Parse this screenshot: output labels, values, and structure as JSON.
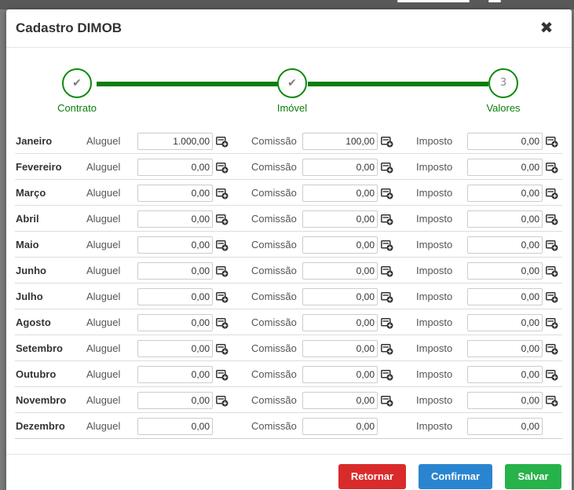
{
  "dialog": {
    "title": "Cadastro DIMOB",
    "close_glyph": "✖"
  },
  "stepper": {
    "steps": [
      {
        "label": "Contrato",
        "state": "done",
        "glyph": "✔"
      },
      {
        "label": "Imóvel",
        "state": "done",
        "glyph": "✔"
      },
      {
        "label": "Valores",
        "state": "current",
        "glyph": "3"
      }
    ],
    "color": "#0a7d0a"
  },
  "columns": {
    "aluguel": "Aluguel",
    "comissao": "Comissão",
    "imposto": "Imposto"
  },
  "months": [
    {
      "name": "Janeiro",
      "aluguel": "1.000,00",
      "comissao": "100,00",
      "imposto": "0,00",
      "has_calc": true
    },
    {
      "name": "Fevereiro",
      "aluguel": "0,00",
      "comissao": "0,00",
      "imposto": "0,00",
      "has_calc": true
    },
    {
      "name": "Março",
      "aluguel": "0,00",
      "comissao": "0,00",
      "imposto": "0,00",
      "has_calc": true
    },
    {
      "name": "Abril",
      "aluguel": "0,00",
      "comissao": "0,00",
      "imposto": "0,00",
      "has_calc": true
    },
    {
      "name": "Maio",
      "aluguel": "0,00",
      "comissao": "0,00",
      "imposto": "0,00",
      "has_calc": true
    },
    {
      "name": "Junho",
      "aluguel": "0,00",
      "comissao": "0,00",
      "imposto": "0,00",
      "has_calc": true
    },
    {
      "name": "Julho",
      "aluguel": "0,00",
      "comissao": "0,00",
      "imposto": "0,00",
      "has_calc": true
    },
    {
      "name": "Agosto",
      "aluguel": "0,00",
      "comissao": "0,00",
      "imposto": "0,00",
      "has_calc": true
    },
    {
      "name": "Setembro",
      "aluguel": "0,00",
      "comissao": "0,00",
      "imposto": "0,00",
      "has_calc": true
    },
    {
      "name": "Outubro",
      "aluguel": "0,00",
      "comissao": "0,00",
      "imposto": "0,00",
      "has_calc": true
    },
    {
      "name": "Novembro",
      "aluguel": "0,00",
      "comissao": "0,00",
      "imposto": "0,00",
      "has_calc": true
    },
    {
      "name": "Dezembro",
      "aluguel": "0,00",
      "comissao": "0,00",
      "imposto": "0,00",
      "has_calc": false
    }
  ],
  "footer": {
    "retornar": "Retornar",
    "confirmar": "Confirmar",
    "salvar": "Salvar"
  },
  "colors": {
    "danger": "#d92b2b",
    "primary": "#2a85d0",
    "success": "#27b24a"
  }
}
